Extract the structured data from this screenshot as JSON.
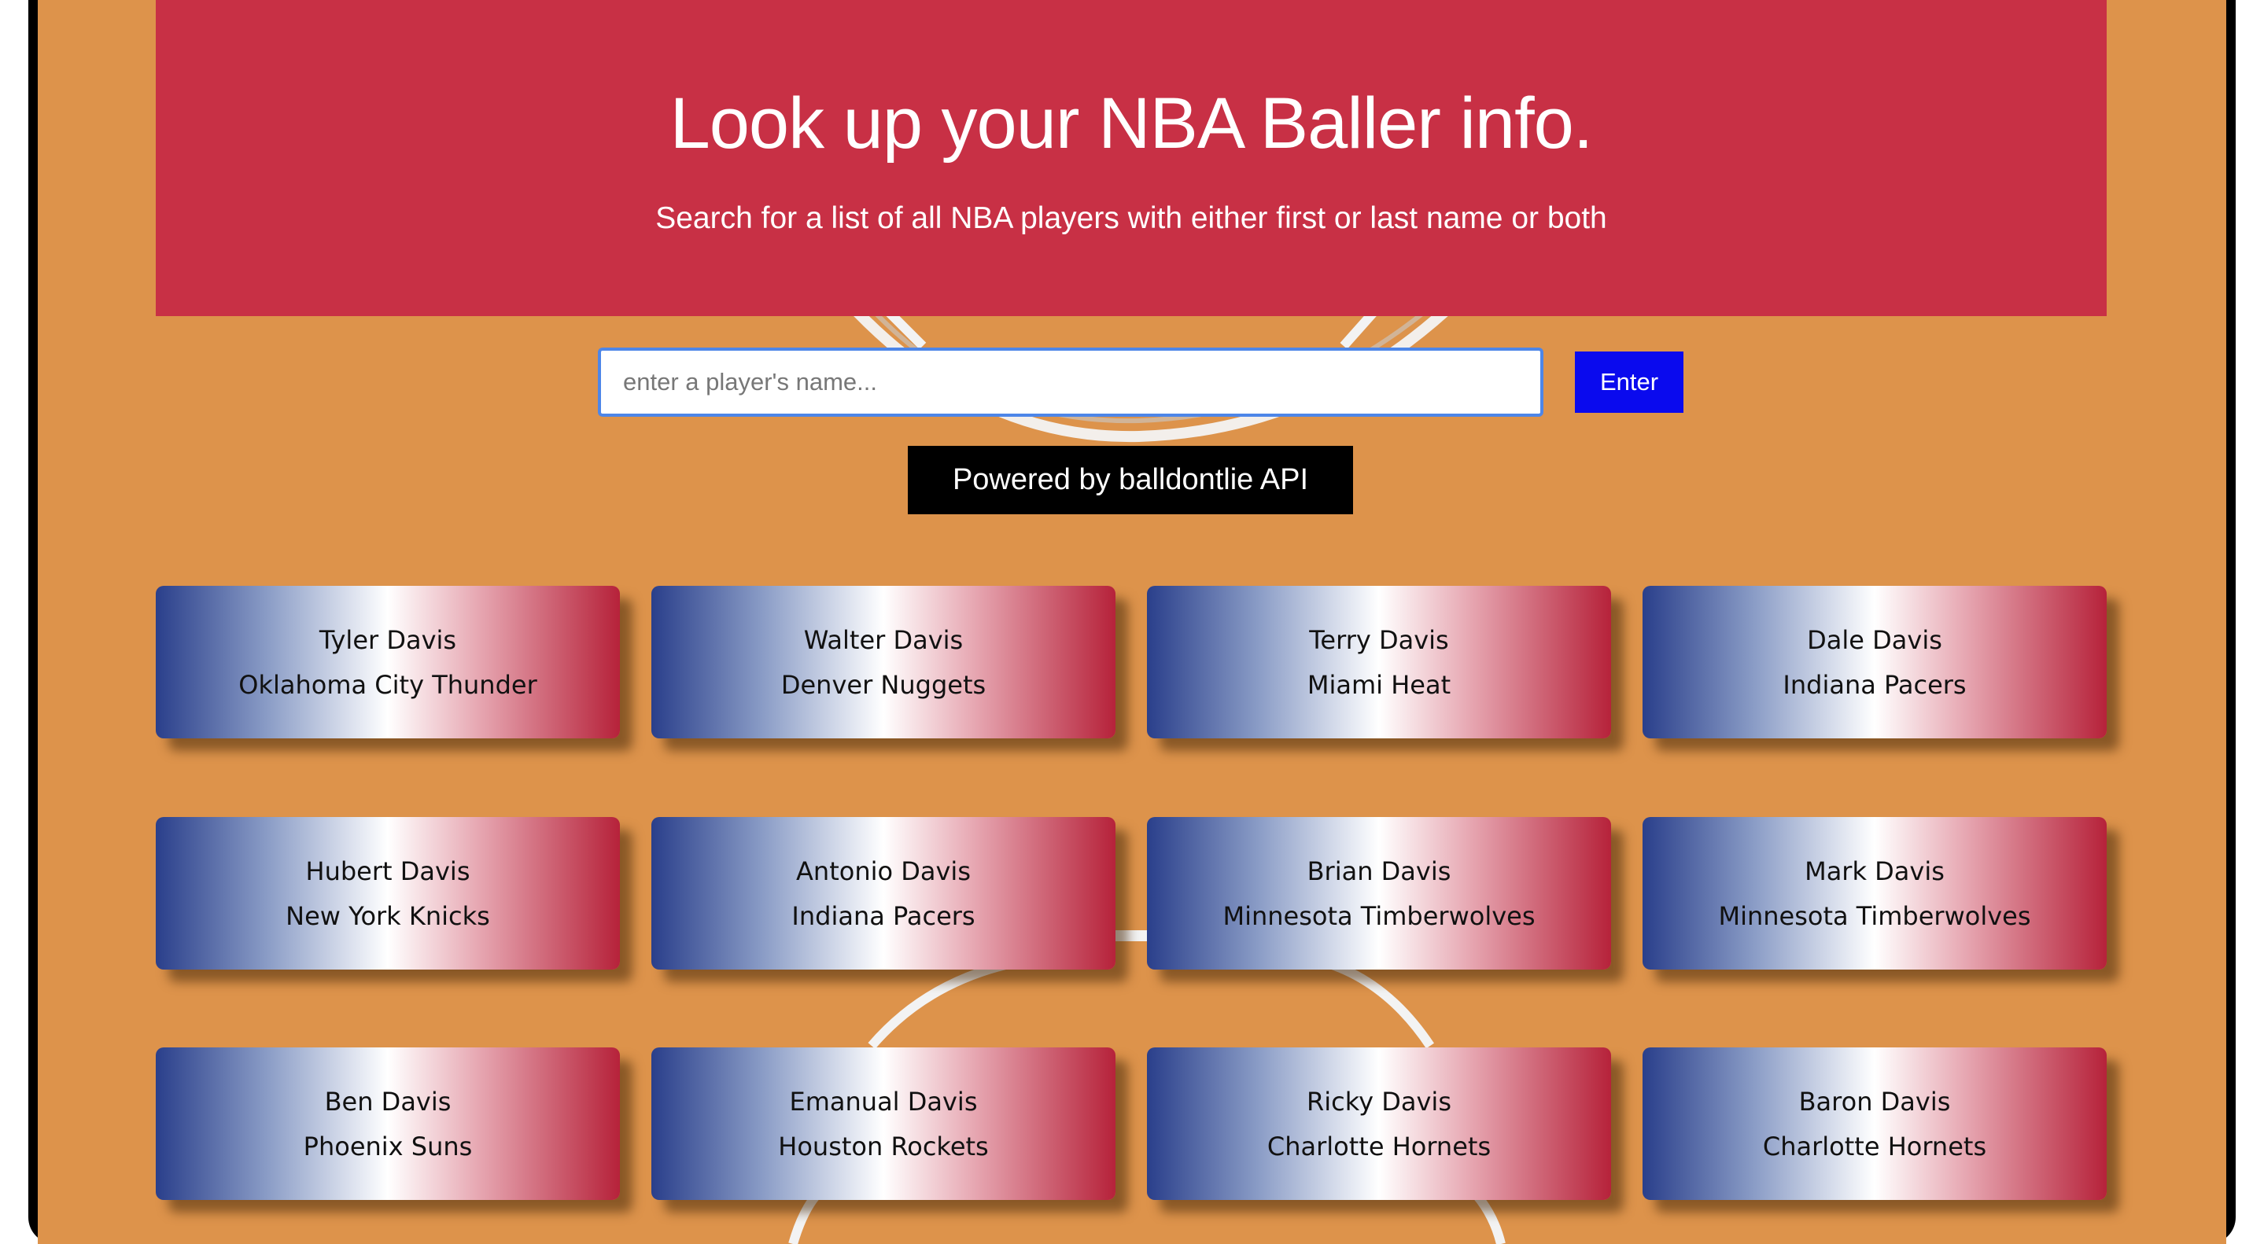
{
  "hero": {
    "title": "Look up your NBA Baller info.",
    "subtitle": "Search for a list of all NBA players with either first or last name or both"
  },
  "search": {
    "placeholder": "enter a player's name...",
    "value": "",
    "button_label": "Enter"
  },
  "powered_by": "Powered by balldontlie API",
  "players": [
    {
      "name": "Tyler Davis",
      "team": "Oklahoma City Thunder"
    },
    {
      "name": "Walter Davis",
      "team": "Denver Nuggets"
    },
    {
      "name": "Terry Davis",
      "team": "Miami Heat"
    },
    {
      "name": "Dale Davis",
      "team": "Indiana Pacers"
    },
    {
      "name": "Hubert Davis",
      "team": "New York Knicks"
    },
    {
      "name": "Antonio Davis",
      "team": "Indiana Pacers"
    },
    {
      "name": "Brian Davis",
      "team": "Minnesota Timberwolves"
    },
    {
      "name": "Mark Davis",
      "team": "Minnesota Timberwolves"
    },
    {
      "name": "Ben Davis",
      "team": "Phoenix Suns"
    },
    {
      "name": "Emanual Davis",
      "team": "Houston Rockets"
    },
    {
      "name": "Ricky Davis",
      "team": "Charlotte Hornets"
    },
    {
      "name": "Baron Davis",
      "team": "Charlotte Hornets"
    }
  ],
  "colors": {
    "court": "#dd934b",
    "hero": "#c83045",
    "button": "#0a0aee",
    "card_blue": "#2a3f8b",
    "card_red": "#b6223a"
  }
}
